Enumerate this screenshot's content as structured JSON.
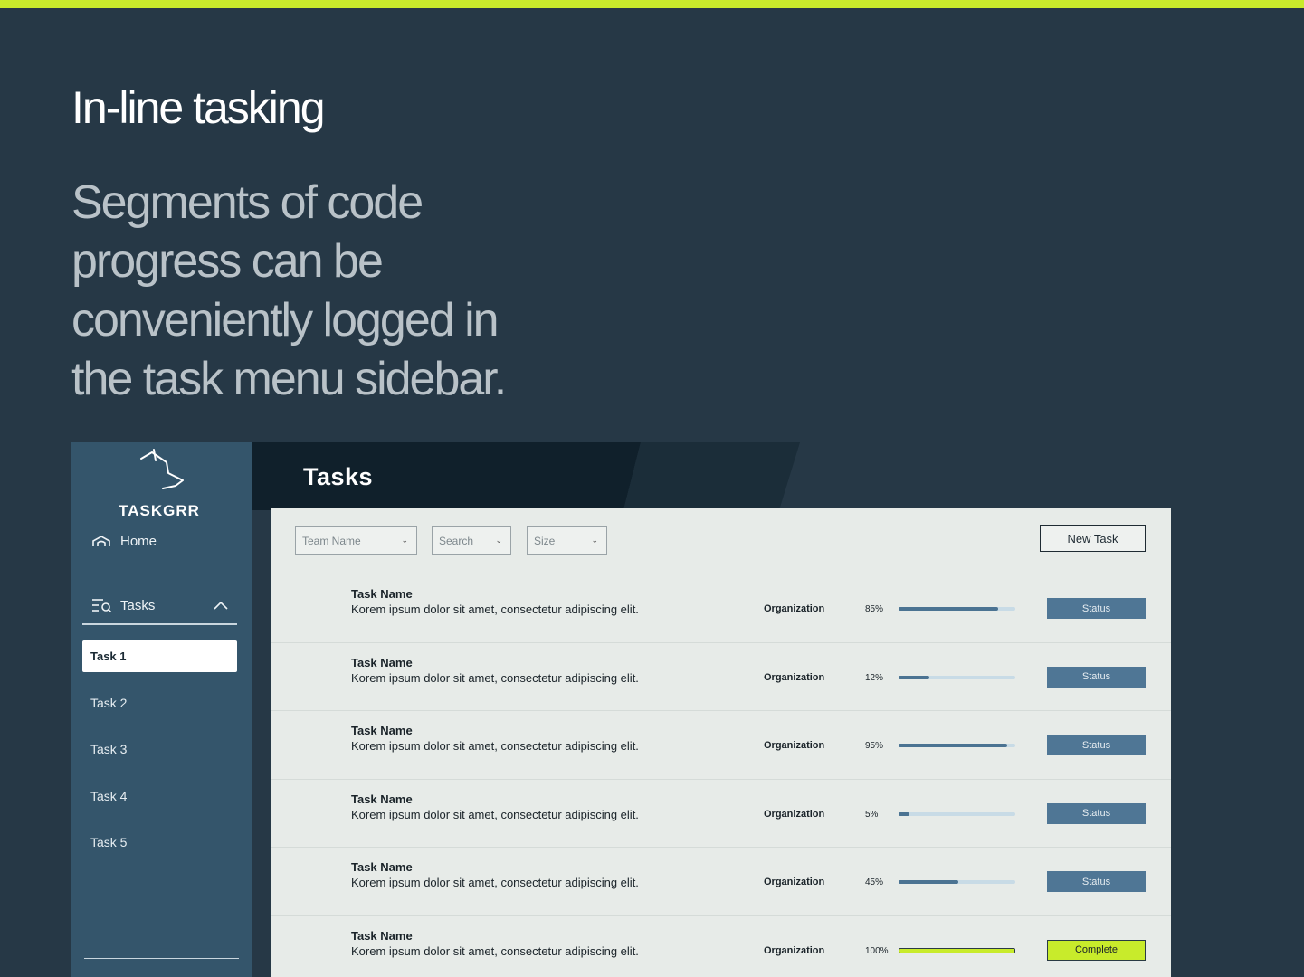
{
  "hero": {
    "title": "In-line tasking",
    "subtitle": "Segments of code progress can be conveniently logged in the task menu sidebar."
  },
  "colors": {
    "background": "#263846",
    "accent": "#c8eb2b",
    "sidebar": "#34556b",
    "status": "#4f7695"
  },
  "sidebar": {
    "logo": "TASKGRR",
    "home_label": "Home",
    "tasks_label": "Tasks",
    "items": [
      {
        "label": "Task 1",
        "active": true
      },
      {
        "label": "Task 2",
        "active": false
      },
      {
        "label": "Task 3",
        "active": false
      },
      {
        "label": "Task 4",
        "active": false
      },
      {
        "label": "Task 5",
        "active": false
      }
    ]
  },
  "main": {
    "title": "Tasks",
    "filters": {
      "team": "Team Name",
      "search": "Search",
      "size": "Size"
    },
    "new_task_label": "New Task",
    "rows": [
      {
        "name": "Task Name",
        "desc": "Korem ipsum dolor sit amet, consectetur adipiscing elit.",
        "org": "Organization",
        "pct": "85%",
        "progress": 0.85,
        "status": "Status"
      },
      {
        "name": "Task Name",
        "desc": "Korem ipsum dolor sit amet, consectetur adipiscing elit.",
        "org": "Organization",
        "pct": "12%",
        "progress": 0.26,
        "status": "Status"
      },
      {
        "name": "Task Name",
        "desc": "Korem ipsum dolor sit amet, consectetur adipiscing elit.",
        "org": "Organization",
        "pct": "95%",
        "progress": 0.93,
        "status": "Status"
      },
      {
        "name": "Task Name",
        "desc": "Korem ipsum dolor sit amet, consectetur adipiscing elit.",
        "org": "Organization",
        "pct": "5%",
        "progress": 0.09,
        "status": "Status"
      },
      {
        "name": "Task Name",
        "desc": "Korem ipsum dolor sit amet, consectetur adipiscing elit.",
        "org": "Organization",
        "pct": "45%",
        "progress": 0.51,
        "status": "Status"
      },
      {
        "name": "Task Name",
        "desc": "Korem ipsum dolor sit amet, consectetur adipiscing elit.",
        "org": "Organization",
        "pct": "100%",
        "progress": 1.0,
        "status": "Complete"
      }
    ]
  }
}
